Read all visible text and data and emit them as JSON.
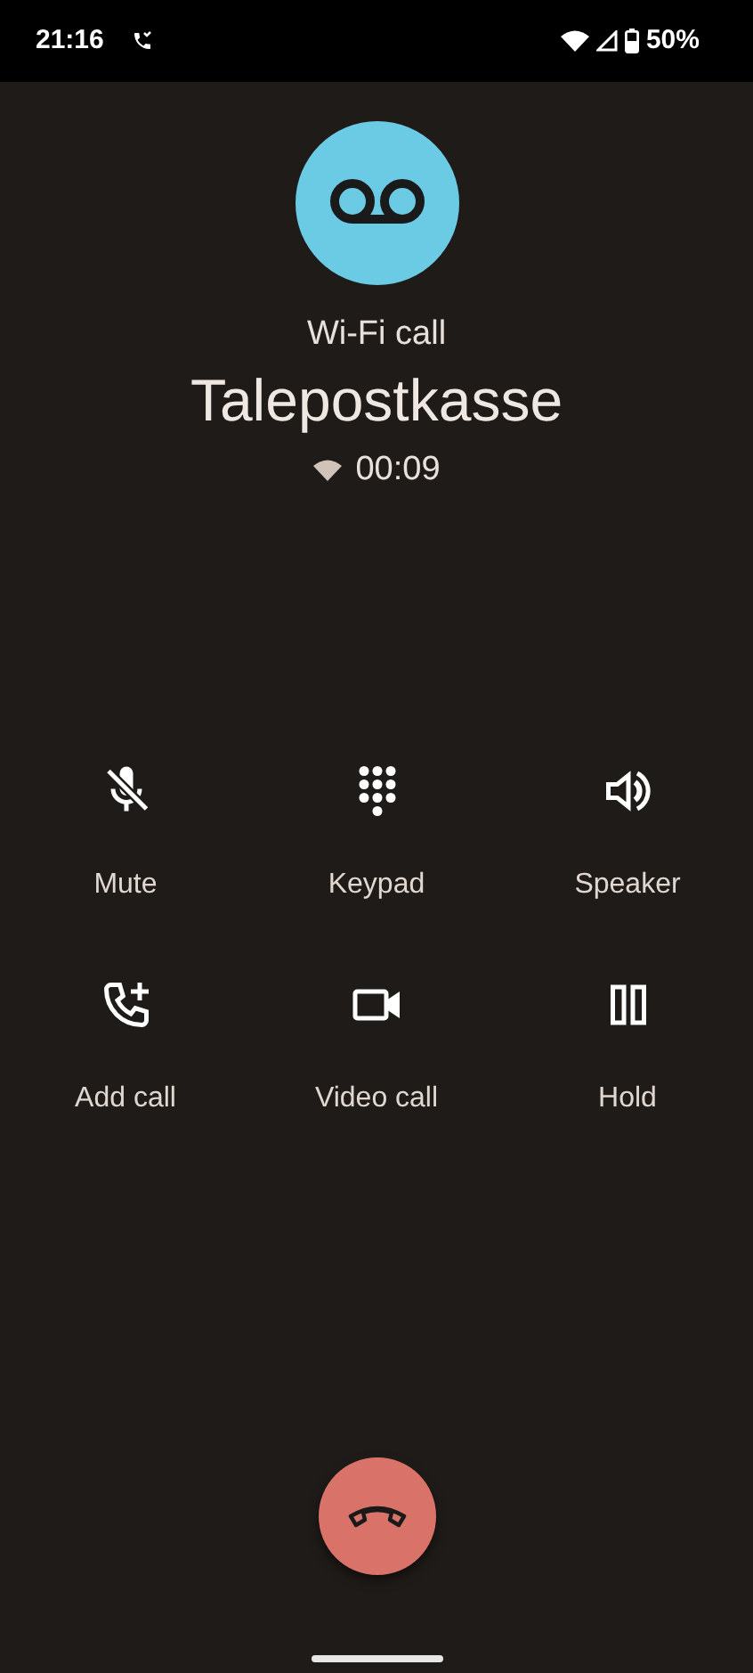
{
  "status_bar": {
    "time": "21:16",
    "battery": "50%"
  },
  "call": {
    "type": "Wi-Fi call",
    "name": "Talepostkasse",
    "duration": "00:09"
  },
  "controls": [
    {
      "kind": "mute",
      "label": "Mute"
    },
    {
      "kind": "keypad",
      "label": "Keypad"
    },
    {
      "kind": "speaker",
      "label": "Speaker"
    },
    {
      "kind": "add",
      "label": "Add call"
    },
    {
      "kind": "video",
      "label": "Video call"
    },
    {
      "kind": "hold",
      "label": "Hold"
    }
  ]
}
